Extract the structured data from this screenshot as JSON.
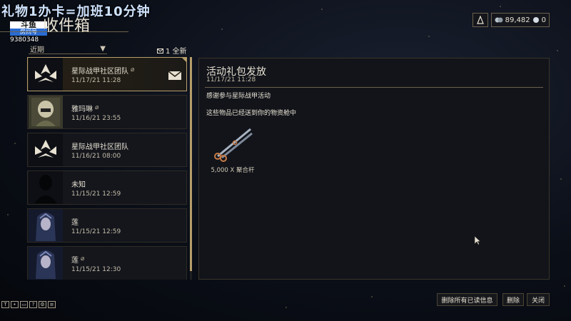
{
  "overlay": {
    "title": "礼物1办卡=加班10分钟",
    "room_logo": "斗鱼",
    "room_label": "房间号",
    "room_number": "9380348"
  },
  "page": {
    "title": "收件箱"
  },
  "currency": {
    "credits": "89,482",
    "platinum": "0"
  },
  "filter": {
    "selected": "近期",
    "new_count": "1 全新"
  },
  "messages": [
    {
      "sender": "星际战甲社区团队",
      "date": "11/17/21 11:28",
      "attachment": true,
      "selected": true,
      "avatar": "lotus-icon"
    },
    {
      "sender": "雅玛琳",
      "date": "11/16/21 23:55",
      "attachment": true,
      "selected": false,
      "avatar": "helmet-portrait"
    },
    {
      "sender": "星际战甲社区团队",
      "date": "11/16/21 08:00",
      "attachment": false,
      "selected": false,
      "avatar": "lotus-icon"
    },
    {
      "sender": "未知",
      "date": "11/15/21 12:59",
      "attachment": false,
      "selected": false,
      "avatar": "silhouette"
    },
    {
      "sender": "莲",
      "date": "11/15/21 12:59",
      "attachment": false,
      "selected": false,
      "avatar": "lotus-portrait"
    },
    {
      "sender": "莲",
      "date": "11/15/21 12:30",
      "attachment": true,
      "selected": false,
      "avatar": "lotus-portrait"
    }
  ],
  "detail": {
    "title": "活动礼包发放",
    "date": "11/17/21 11:28",
    "body_line1": "感谢参与星际战甲活动",
    "body_line2": "这些物品已经送到你的物资舱中",
    "reward_caption": "5,000 X 聚合杆"
  },
  "buttons": {
    "delete_read": "删除所有已读信息",
    "delete": "删除",
    "close": "关闭"
  },
  "colors": {
    "accent_gold": "#b69e6a",
    "panel_bg": "#12141a",
    "text": "#e7e1d2"
  }
}
